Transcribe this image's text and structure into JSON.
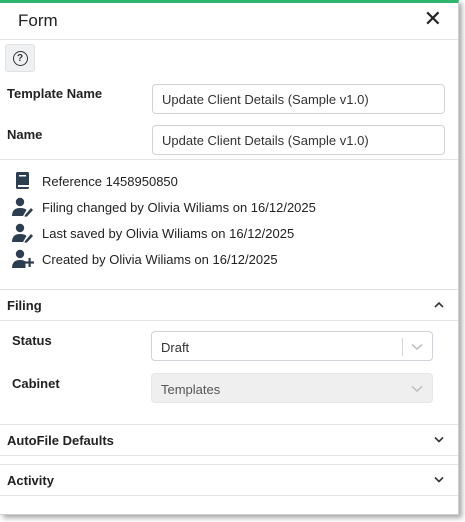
{
  "window": {
    "title": "Form",
    "close_icon": "close-icon"
  },
  "toolbar": {
    "help_glyph": "?",
    "help_icon": "help-circle-icon"
  },
  "fields": {
    "template_name": {
      "label": "Template Name",
      "value": "Update Client Details (Sample v1.0)"
    },
    "name": {
      "label": "Name",
      "value": "Update Client Details (Sample v1.0)"
    }
  },
  "info": [
    {
      "icon": "book-icon",
      "text": "Reference 1458950850"
    },
    {
      "icon": "user-edit-icon",
      "text": "Filing changed by Olivia Wiliams on 16/12/2025"
    },
    {
      "icon": "user-edit-icon",
      "text": "Last saved by Olivia Wiliams on 16/12/2025"
    },
    {
      "icon": "user-plus-icon",
      "text": "Created by Olivia Wiliams on 16/12/2025"
    }
  ],
  "filing": {
    "title": "Filing",
    "expanded": true,
    "status": {
      "label": "Status",
      "value": "Draft"
    },
    "cabinet": {
      "label": "Cabinet",
      "value": "Templates",
      "disabled": true
    }
  },
  "sections": [
    {
      "title": "AutoFile Defaults",
      "expanded": false
    },
    {
      "title": "Activity",
      "expanded": false
    }
  ],
  "colors": {
    "accent_border": "#2fb56d",
    "icon": "#2d3e50"
  }
}
